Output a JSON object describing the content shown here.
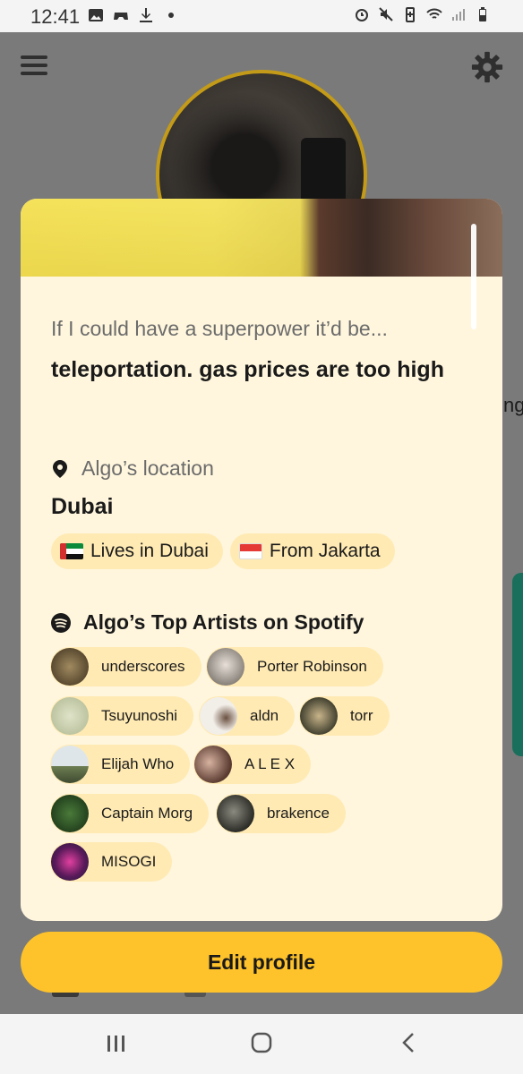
{
  "status_bar": {
    "time": "12:41",
    "left_icons": [
      "image-icon",
      "game-controller-icon",
      "download-icon",
      "dot-icon"
    ],
    "right_icons": [
      "alarm-icon",
      "mute-icon",
      "battery-saver-icon",
      "wifi-icon",
      "signal-icon",
      "battery-icon"
    ]
  },
  "background": {
    "side_text": "ng"
  },
  "card": {
    "prompt_question": "If I could have a superpower it’d be...",
    "prompt_answer": "teleportation. gas prices are too high",
    "location_title": "Algo’s location",
    "city": "Dubai",
    "chips": [
      {
        "flag": "uae-flag",
        "label": "Lives in Dubai"
      },
      {
        "flag": "indonesia-flag",
        "label": "From Jakarta"
      }
    ],
    "spotify_title": "Algo’s Top Artists on Spotify",
    "artists": [
      {
        "name": "underscores",
        "color": "#7a6a4a"
      },
      {
        "name": "Porter Robinson",
        "color": "#b7b2a8"
      },
      {
        "name": "Tsuyunoshi",
        "color": "#c9d0b0"
      },
      {
        "name": "aldn",
        "color": "#efeae4"
      },
      {
        "name": "torr",
        "color": "#4b4a3a"
      },
      {
        "name": "Elijah Who",
        "color": "#8aa07a"
      },
      {
        "name": "A L E X",
        "color": "#6a5040"
      },
      {
        "name": "Captain Morg",
        "color": "#2f5a2a"
      },
      {
        "name": "brakence",
        "color": "#3a3a34"
      },
      {
        "name": "MISOGI",
        "color": "#8a2a6a"
      }
    ]
  },
  "edit_profile_label": "Edit profile",
  "colors": {
    "accent_yellow": "#fec32b",
    "card_bg": "#fff6dd",
    "chip_bg": "#ffeab3"
  }
}
